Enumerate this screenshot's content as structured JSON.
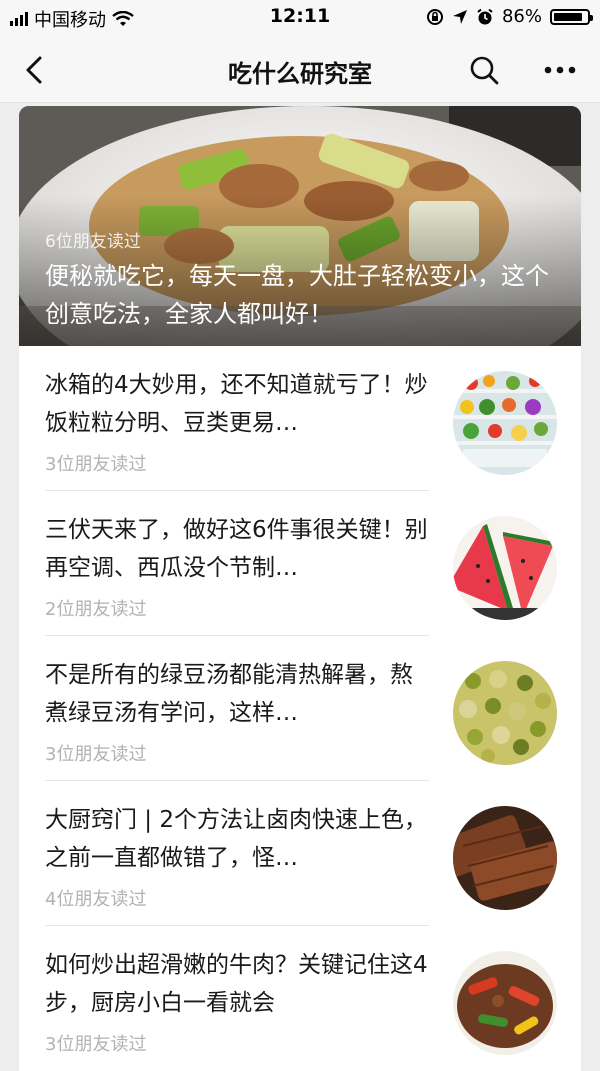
{
  "status": {
    "carrier": "中国移动",
    "time": "12:11",
    "battery": "86%",
    "battery_level": 0.86
  },
  "nav": {
    "title": "吃什么研究室",
    "back_icon": "chevron-left-icon",
    "search_icon": "search-icon",
    "more_icon": "more-dots-icon"
  },
  "hero": {
    "readers": "6位朋友读过",
    "title": "便秘就吃它，每天一盘，大肚子轻松变小，这个创意吃法，全家人都叫好！"
  },
  "articles": [
    {
      "title": "冰箱的4大妙用，还不知道就亏了！炒饭粒粒分明、豆类更易…",
      "readers": "3位朋友读过",
      "thumb": "fridge"
    },
    {
      "title": "三伏天来了，做好这6件事很关键！别再空调、西瓜没个节制…",
      "readers": "2位朋友读过",
      "thumb": "watermelon"
    },
    {
      "title": "不是所有的绿豆汤都能清热解暑，熬煮绿豆汤有学问，这样…",
      "readers": "3位朋友读过",
      "thumb": "mung-bean"
    },
    {
      "title": "大厨窍门 | 2个方法让卤肉快速上色，之前一直都做错了，怪…",
      "readers": "4位朋友读过",
      "thumb": "braised-meat"
    },
    {
      "title": "如何炒出超滑嫩的牛肉？关键记住这4步，厨房小白一看就会",
      "readers": "3位朋友读过",
      "thumb": "beef"
    }
  ]
}
